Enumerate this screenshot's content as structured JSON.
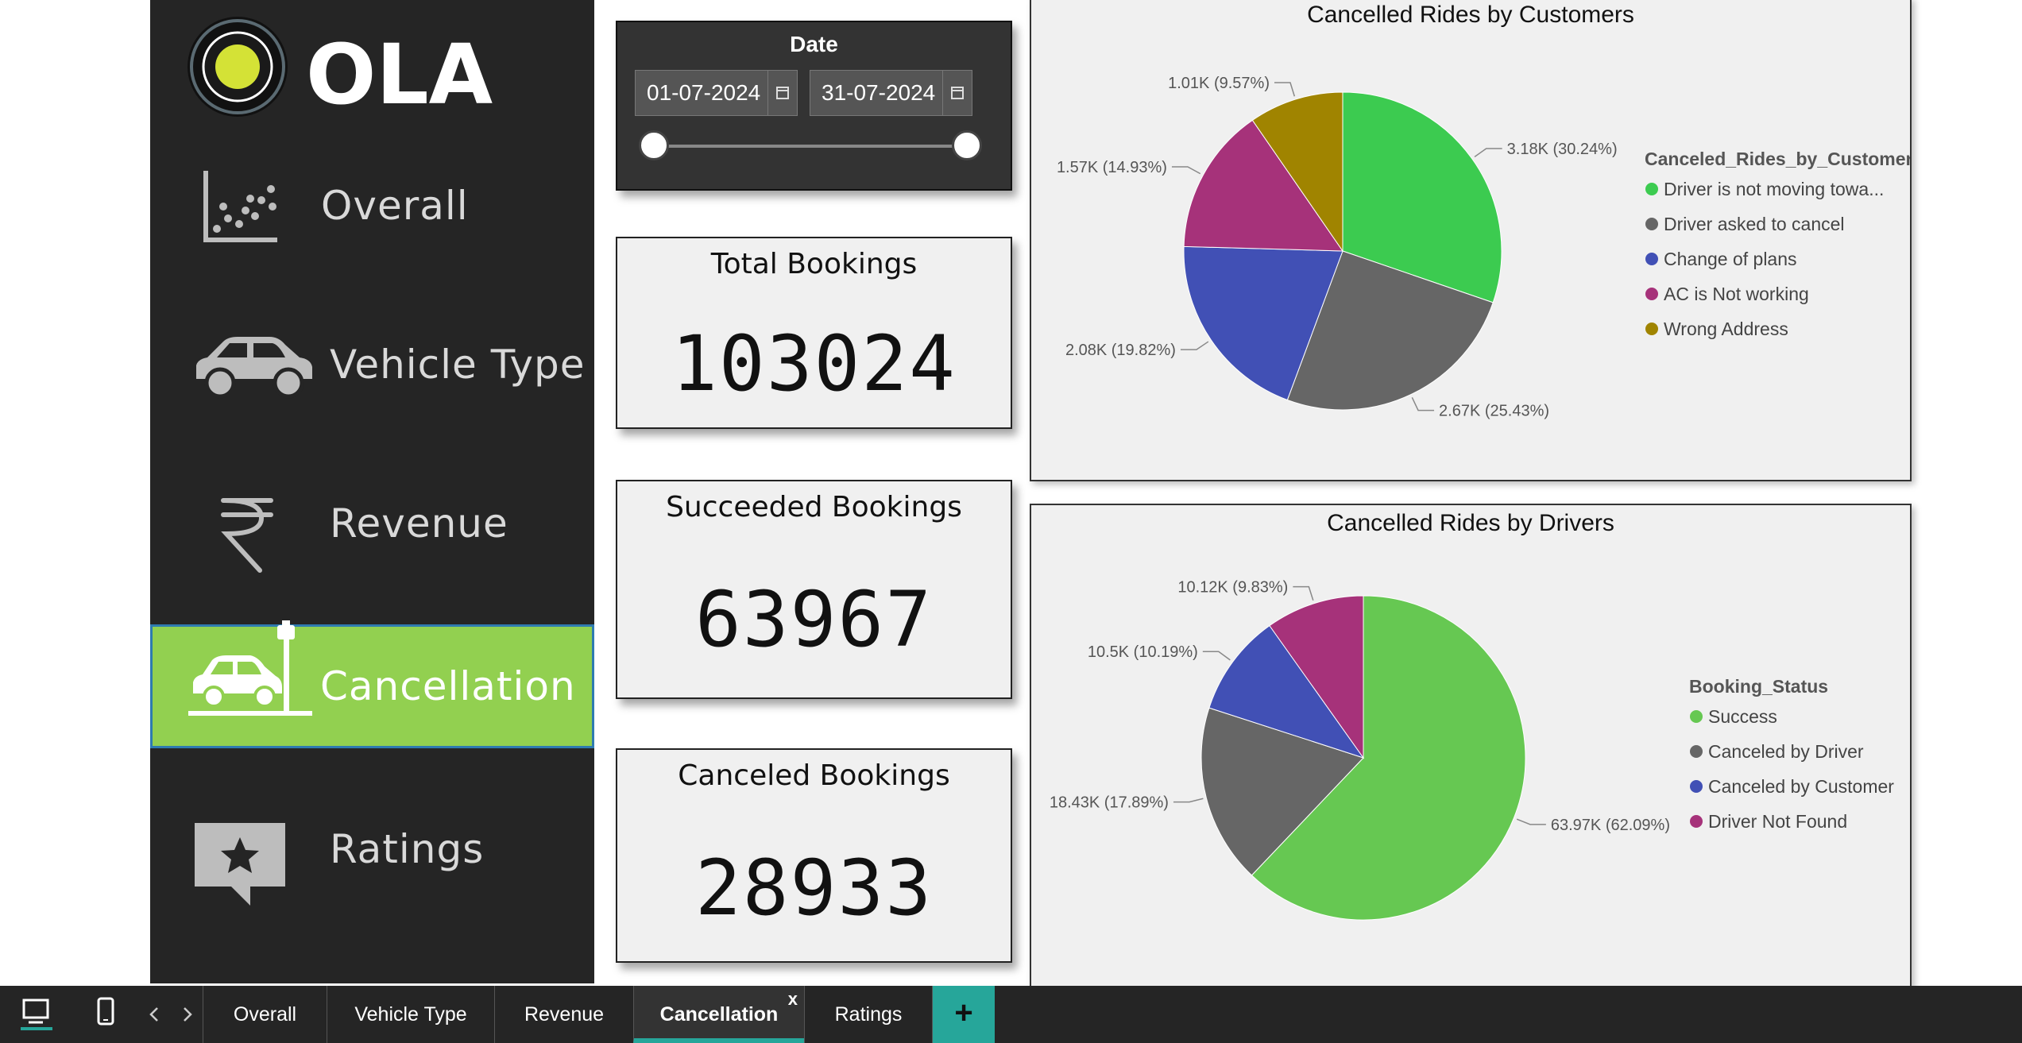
{
  "nav": {
    "brand": "OLA",
    "items": [
      {
        "label": "Overall",
        "icon": "scatter-plot-icon"
      },
      {
        "label": "Vehicle Type",
        "icon": "car-icon"
      },
      {
        "label": "Revenue",
        "icon": "rupee-icon"
      },
      {
        "label": "Cancellation",
        "icon": "car-crash-icon",
        "active": true
      },
      {
        "label": "Ratings",
        "icon": "star-chat-icon"
      }
    ]
  },
  "date_slicer": {
    "title": "Date",
    "start": "01-07-2024",
    "end": "31-07-2024"
  },
  "kpis": {
    "total": {
      "title": "Total Bookings",
      "value": "103024"
    },
    "succeeded": {
      "title": "Succeeded Bookings",
      "value": "63967"
    },
    "canceled": {
      "title": "Canceled Bookings",
      "value": "28933"
    }
  },
  "chart_data": [
    {
      "type": "pie",
      "title": "Cancelled Rides by Customers",
      "legend_title": "Canceled_Rides_by_Customer",
      "legend_position": "right",
      "slices": [
        {
          "name": "Driver is not moving towa...",
          "value": 3180,
          "label": "3.18K (30.24%)",
          "color": "#3ccb50"
        },
        {
          "name": "Driver asked to cancel",
          "value": 2670,
          "label": "2.67K (25.43%)",
          "color": "#666666"
        },
        {
          "name": "Change of plans",
          "value": 2080,
          "label": "2.08K (19.82%)",
          "color": "#4150b5"
        },
        {
          "name": "AC is Not working",
          "value": 1570,
          "label": "1.57K (14.93%)",
          "color": "#a6327a"
        },
        {
          "name": "Wrong Address",
          "value": 1010,
          "label": "1.01K (9.57%)",
          "color": "#a08400"
        }
      ]
    },
    {
      "type": "pie",
      "title": "Cancelled Rides by Drivers",
      "legend_title": "Booking_Status",
      "legend_position": "right",
      "slices": [
        {
          "name": "Success",
          "value": 63970,
          "label": "63.97K (62.09%)",
          "color": "#66c852"
        },
        {
          "name": "Canceled by Driver",
          "value": 18430,
          "label": "18.43K (17.89%)",
          "color": "#666666"
        },
        {
          "name": "Canceled by Customer",
          "value": 10500,
          "label": "10.5K (10.19%)",
          "color": "#4150b5"
        },
        {
          "name": "Driver Not Found",
          "value": 10120,
          "label": "10.12K (9.83%)",
          "color": "#a6327a"
        }
      ]
    }
  ],
  "tabs": [
    {
      "label": "Overall"
    },
    {
      "label": "Vehicle Type"
    },
    {
      "label": "Revenue"
    },
    {
      "label": "Cancellation",
      "active": true,
      "close": "x"
    },
    {
      "label": "Ratings"
    }
  ],
  "add_tab": "+"
}
